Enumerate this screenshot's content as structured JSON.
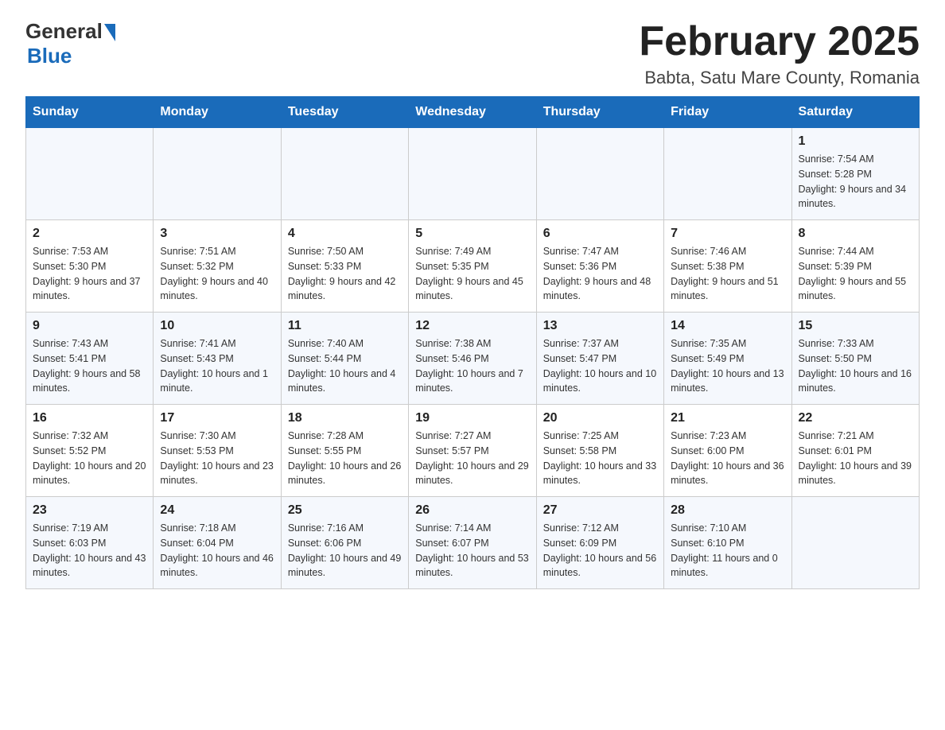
{
  "logo": {
    "general": "General",
    "blue": "Blue"
  },
  "title": "February 2025",
  "location": "Babta, Satu Mare County, Romania",
  "days_header": [
    "Sunday",
    "Monday",
    "Tuesday",
    "Wednesday",
    "Thursday",
    "Friday",
    "Saturday"
  ],
  "weeks": [
    [
      {
        "day": "",
        "info": ""
      },
      {
        "day": "",
        "info": ""
      },
      {
        "day": "",
        "info": ""
      },
      {
        "day": "",
        "info": ""
      },
      {
        "day": "",
        "info": ""
      },
      {
        "day": "",
        "info": ""
      },
      {
        "day": "1",
        "info": "Sunrise: 7:54 AM\nSunset: 5:28 PM\nDaylight: 9 hours and 34 minutes."
      }
    ],
    [
      {
        "day": "2",
        "info": "Sunrise: 7:53 AM\nSunset: 5:30 PM\nDaylight: 9 hours and 37 minutes."
      },
      {
        "day": "3",
        "info": "Sunrise: 7:51 AM\nSunset: 5:32 PM\nDaylight: 9 hours and 40 minutes."
      },
      {
        "day": "4",
        "info": "Sunrise: 7:50 AM\nSunset: 5:33 PM\nDaylight: 9 hours and 42 minutes."
      },
      {
        "day": "5",
        "info": "Sunrise: 7:49 AM\nSunset: 5:35 PM\nDaylight: 9 hours and 45 minutes."
      },
      {
        "day": "6",
        "info": "Sunrise: 7:47 AM\nSunset: 5:36 PM\nDaylight: 9 hours and 48 minutes."
      },
      {
        "day": "7",
        "info": "Sunrise: 7:46 AM\nSunset: 5:38 PM\nDaylight: 9 hours and 51 minutes."
      },
      {
        "day": "8",
        "info": "Sunrise: 7:44 AM\nSunset: 5:39 PM\nDaylight: 9 hours and 55 minutes."
      }
    ],
    [
      {
        "day": "9",
        "info": "Sunrise: 7:43 AM\nSunset: 5:41 PM\nDaylight: 9 hours and 58 minutes."
      },
      {
        "day": "10",
        "info": "Sunrise: 7:41 AM\nSunset: 5:43 PM\nDaylight: 10 hours and 1 minute."
      },
      {
        "day": "11",
        "info": "Sunrise: 7:40 AM\nSunset: 5:44 PM\nDaylight: 10 hours and 4 minutes."
      },
      {
        "day": "12",
        "info": "Sunrise: 7:38 AM\nSunset: 5:46 PM\nDaylight: 10 hours and 7 minutes."
      },
      {
        "day": "13",
        "info": "Sunrise: 7:37 AM\nSunset: 5:47 PM\nDaylight: 10 hours and 10 minutes."
      },
      {
        "day": "14",
        "info": "Sunrise: 7:35 AM\nSunset: 5:49 PM\nDaylight: 10 hours and 13 minutes."
      },
      {
        "day": "15",
        "info": "Sunrise: 7:33 AM\nSunset: 5:50 PM\nDaylight: 10 hours and 16 minutes."
      }
    ],
    [
      {
        "day": "16",
        "info": "Sunrise: 7:32 AM\nSunset: 5:52 PM\nDaylight: 10 hours and 20 minutes."
      },
      {
        "day": "17",
        "info": "Sunrise: 7:30 AM\nSunset: 5:53 PM\nDaylight: 10 hours and 23 minutes."
      },
      {
        "day": "18",
        "info": "Sunrise: 7:28 AM\nSunset: 5:55 PM\nDaylight: 10 hours and 26 minutes."
      },
      {
        "day": "19",
        "info": "Sunrise: 7:27 AM\nSunset: 5:57 PM\nDaylight: 10 hours and 29 minutes."
      },
      {
        "day": "20",
        "info": "Sunrise: 7:25 AM\nSunset: 5:58 PM\nDaylight: 10 hours and 33 minutes."
      },
      {
        "day": "21",
        "info": "Sunrise: 7:23 AM\nSunset: 6:00 PM\nDaylight: 10 hours and 36 minutes."
      },
      {
        "day": "22",
        "info": "Sunrise: 7:21 AM\nSunset: 6:01 PM\nDaylight: 10 hours and 39 minutes."
      }
    ],
    [
      {
        "day": "23",
        "info": "Sunrise: 7:19 AM\nSunset: 6:03 PM\nDaylight: 10 hours and 43 minutes."
      },
      {
        "day": "24",
        "info": "Sunrise: 7:18 AM\nSunset: 6:04 PM\nDaylight: 10 hours and 46 minutes."
      },
      {
        "day": "25",
        "info": "Sunrise: 7:16 AM\nSunset: 6:06 PM\nDaylight: 10 hours and 49 minutes."
      },
      {
        "day": "26",
        "info": "Sunrise: 7:14 AM\nSunset: 6:07 PM\nDaylight: 10 hours and 53 minutes."
      },
      {
        "day": "27",
        "info": "Sunrise: 7:12 AM\nSunset: 6:09 PM\nDaylight: 10 hours and 56 minutes."
      },
      {
        "day": "28",
        "info": "Sunrise: 7:10 AM\nSunset: 6:10 PM\nDaylight: 11 hours and 0 minutes."
      },
      {
        "day": "",
        "info": ""
      }
    ]
  ]
}
